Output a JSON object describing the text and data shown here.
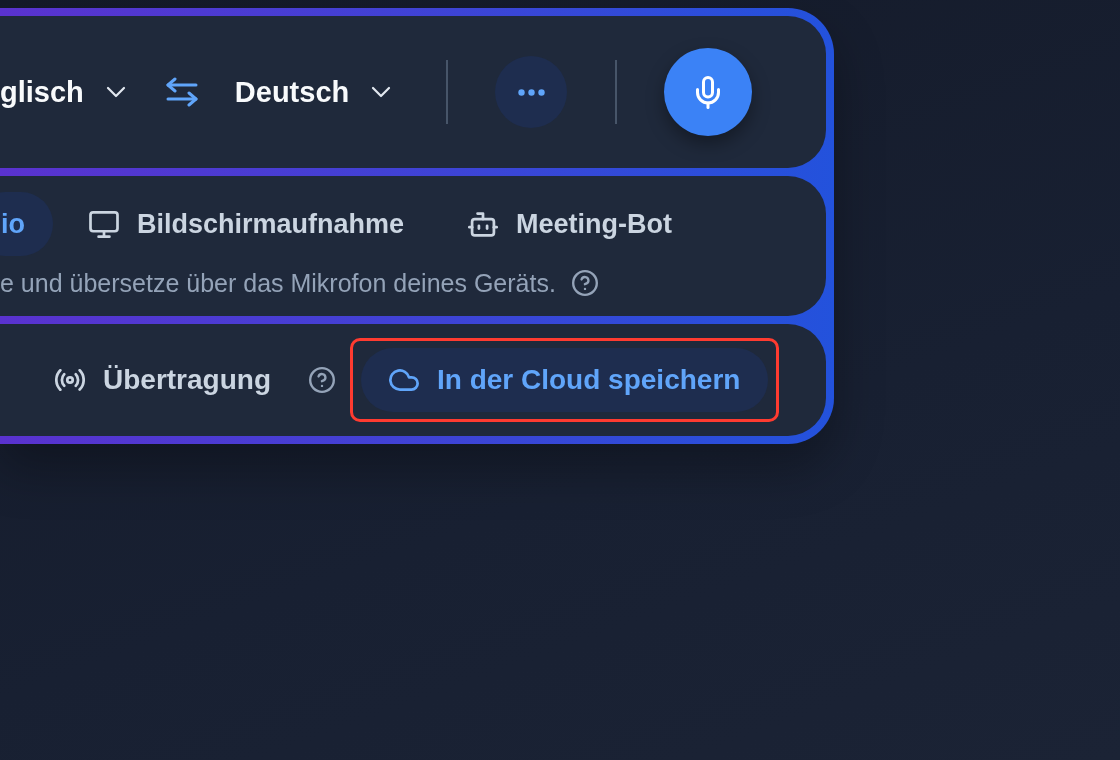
{
  "language_bar": {
    "source_language": "glisch",
    "target_language": "Deutsch"
  },
  "modes": [
    {
      "label": "io",
      "selected": true
    },
    {
      "label": "Bildschirmaufnahme",
      "selected": false
    },
    {
      "label": "Meeting-Bot",
      "selected": false
    }
  ],
  "mode_description": "e und übersetze über das Mikrofon deines Geräts.",
  "options": [
    {
      "label": "Übertragung",
      "on": false,
      "help": true,
      "highlighted": false
    },
    {
      "label": "In der Cloud speichern",
      "on": true,
      "help": false,
      "highlighted": true
    }
  ]
}
